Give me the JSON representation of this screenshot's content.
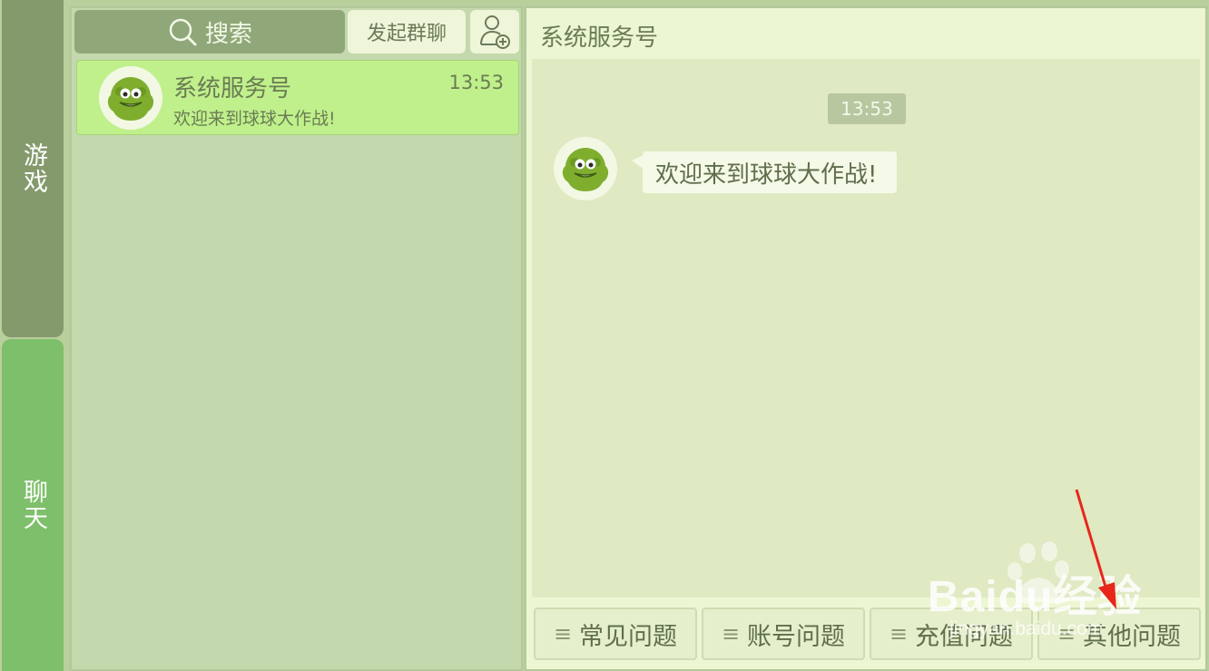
{
  "sidebar": {
    "tabs": [
      {
        "label": "游戏",
        "active": false
      },
      {
        "label": "聊天",
        "active": true
      }
    ]
  },
  "list": {
    "search_label": "搜索",
    "group_chat_label": "发起群聊",
    "add_friend_icon": "add-friend-icon",
    "items": [
      {
        "name": "系统服务号",
        "preview": "欢迎来到球球大作战!",
        "time": "13:53"
      }
    ]
  },
  "conversation": {
    "title": "系统服务号",
    "timestamp": "13:53",
    "messages": [
      {
        "text": "欢迎来到球球大作战!"
      }
    ],
    "quick_replies": [
      {
        "label": "常见问题"
      },
      {
        "label": "账号问题"
      },
      {
        "label": "充值问题"
      },
      {
        "label": "其他问题"
      }
    ]
  },
  "watermark": {
    "brand": "Baidu经验",
    "url": "jingyan.baidu.com"
  },
  "colors": {
    "accent_green": "#7dbf6a",
    "selected_item": "#c0f08c",
    "annotation_arrow": "#e8261a"
  }
}
